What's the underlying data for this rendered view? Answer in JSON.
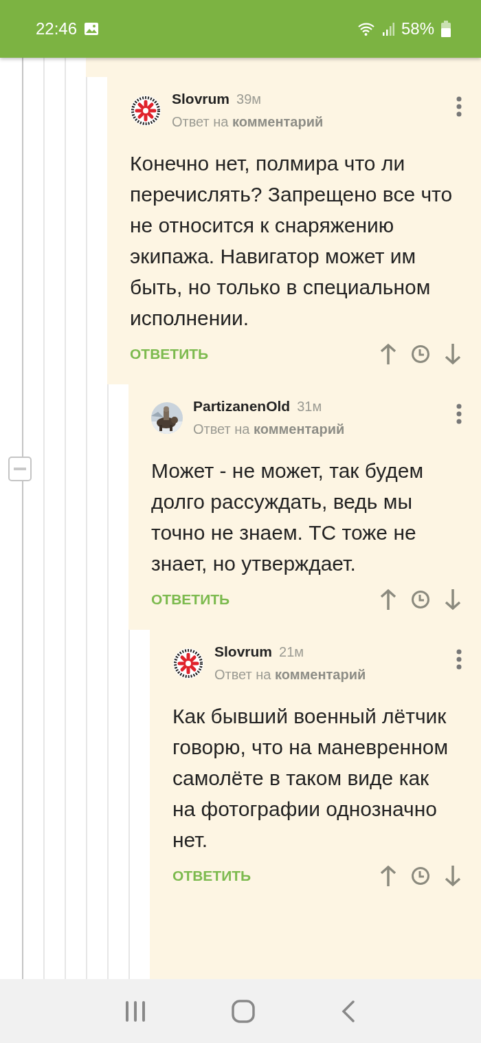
{
  "status_bar": {
    "time": "22:46",
    "battery": "58%"
  },
  "comments": [
    {
      "author": "Slovrum",
      "time": "39м",
      "reply_prefix": "Ответ на",
      "reply_link": "комментарий",
      "kind": "logo",
      "body": "Конечно нет, полмира что ли перечислять? Запрещено все что не относится к снаряжению экипажа. Навигатор может им быть, но только в специальном исполнении.",
      "action": "ОТВЕТИТЬ"
    },
    {
      "author": "PartizanenOld",
      "time": "31м",
      "reply_prefix": "Ответ на",
      "reply_link": "комментарий",
      "kind": "picture",
      "body": "Может - не может, так будем долго рассуждать, ведь мы точно не знаем. ТС тоже не знает, но утверждает.",
      "action": "ОТВЕТИТЬ"
    },
    {
      "author": "Slovrum",
      "time": "21м",
      "reply_prefix": "Ответ на",
      "reply_link": "комментарий",
      "kind": "logo",
      "body": "Как бывший военный лётчик говорю, что на маневренном самолёте в таком виде как на фотографии однозначно нет.",
      "action": "ОТВЕТИТЬ"
    }
  ]
}
